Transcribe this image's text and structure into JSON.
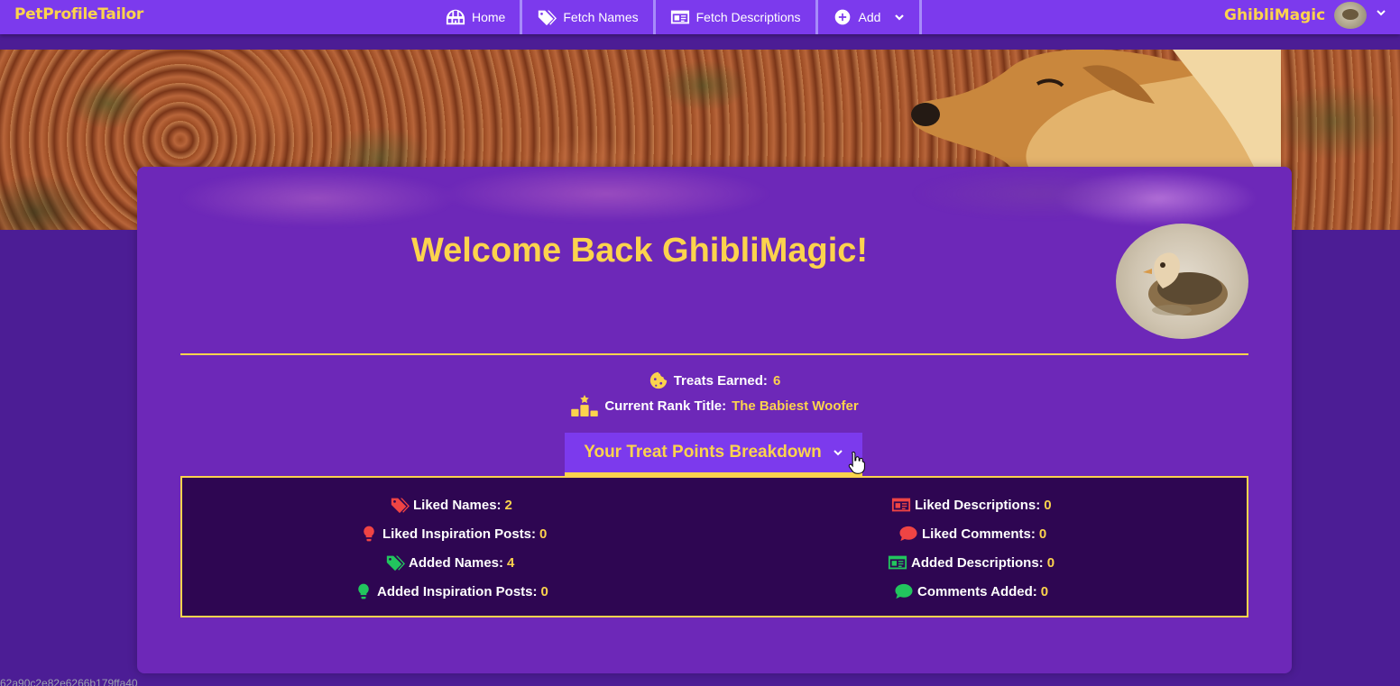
{
  "nav": {
    "brand": "PetProfileTailor",
    "items": [
      {
        "label": "Home",
        "icon": "igloo-icon"
      },
      {
        "label": "Fetch Names",
        "icon": "tags-icon"
      },
      {
        "label": "Fetch Descriptions",
        "icon": "id-card-icon"
      },
      {
        "label": "Add",
        "icon": "plus-circle-icon",
        "dropdown": true
      }
    ],
    "user": {
      "name": "GhibliMagic"
    }
  },
  "welcome": {
    "title": "Welcome Back GhibliMagic!"
  },
  "stats": {
    "treats_label": "Treats Earned:",
    "treats_value": "6",
    "rank_label": "Current Rank Title:",
    "rank_value": "The Babiest Woofer"
  },
  "breakdown": {
    "button_label": "Your Treat Points Breakdown",
    "left": [
      {
        "label": "Liked Names:",
        "value": "2",
        "icon": "tags-icon",
        "color": "#ef4444"
      },
      {
        "label": "Liked Inspiration Posts:",
        "value": "0",
        "icon": "lightbulb-icon",
        "color": "#ef4444"
      },
      {
        "label": "Added Names:",
        "value": "4",
        "icon": "tags-icon",
        "color": "#22c55e"
      },
      {
        "label": "Added Inspiration Posts:",
        "value": "0",
        "icon": "lightbulb-icon",
        "color": "#22c55e"
      }
    ],
    "right": [
      {
        "label": "Liked Descriptions:",
        "value": "0",
        "icon": "id-card-icon",
        "color": "#ef4444"
      },
      {
        "label": "Liked Comments:",
        "value": "0",
        "icon": "comment-icon",
        "color": "#ef4444"
      },
      {
        "label": "Added Descriptions:",
        "value": "0",
        "icon": "id-card-icon",
        "color": "#22c55e"
      },
      {
        "label": "Comments Added:",
        "value": "0",
        "icon": "comment-icon",
        "color": "#22c55e"
      }
    ]
  },
  "footer": {
    "id_text": "62a90c2e82e6266b179ffa40"
  },
  "colors": {
    "accent": "#fcd34d",
    "nav": "#7c3aed",
    "card": "#6d28b8",
    "panel": "#2e0652"
  }
}
